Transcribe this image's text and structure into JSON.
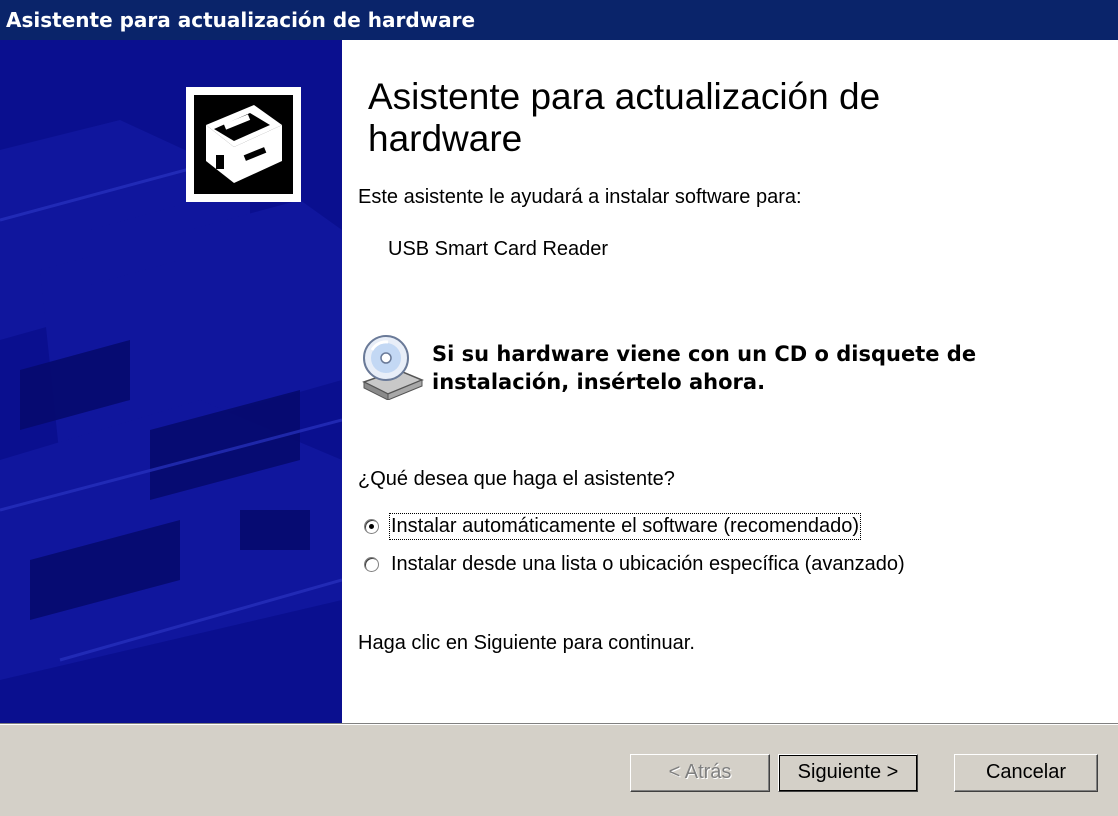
{
  "window": {
    "title": "Asistente para actualización de hardware"
  },
  "main": {
    "heading": "Asistente para actualización de hardware",
    "intro": "Este asistente le ayudará a instalar software para:",
    "device_name": "USB Smart Card Reader",
    "cd_message": "Si su hardware viene con un CD o disquete de instalación, insértelo ahora.",
    "question": "¿Qué desea que haga el asistente?",
    "options": [
      {
        "label": "Instalar automáticamente el software (recomendado)",
        "selected": true
      },
      {
        "label": "Instalar desde una lista o ubicación específica (avanzado)",
        "selected": false
      }
    ],
    "continue_hint": "Haga clic en Siguiente para continuar."
  },
  "footer": {
    "back_label": "< Atrás",
    "next_label": "Siguiente >",
    "cancel_label": "Cancelar"
  },
  "icons": {
    "banner": "hardware-box-icon",
    "cd": "cd-drive-icon"
  },
  "colors": {
    "titlebar": "#0a246a",
    "banner": "#0a0f8f",
    "face": "#d4d0c8"
  }
}
